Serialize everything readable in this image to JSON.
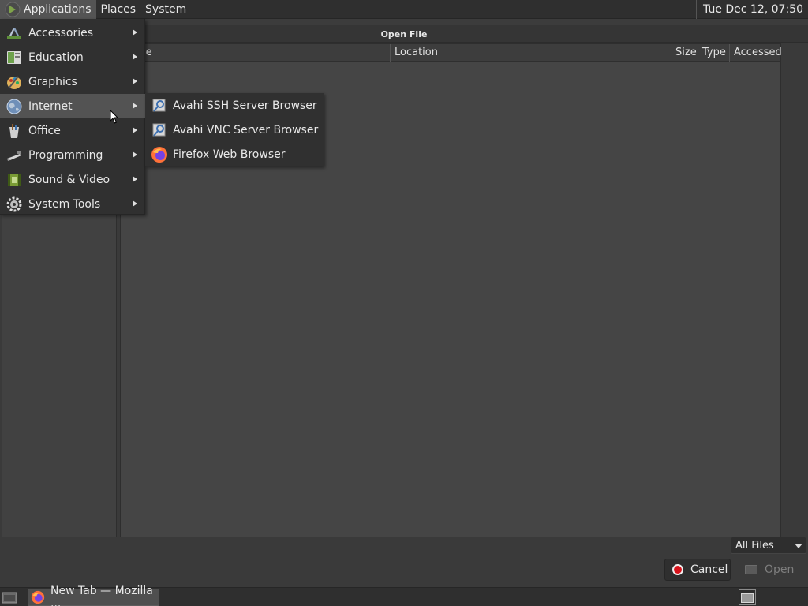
{
  "top_panel": {
    "menus": [
      {
        "label": "Applications"
      },
      {
        "label": "Places"
      },
      {
        "label": "System"
      }
    ],
    "clock": "Tue Dec 12, 07:50"
  },
  "dialog": {
    "title": "Open File",
    "columns": [
      "me",
      "Location",
      "Size",
      "Type",
      "Accessed"
    ],
    "filter": {
      "selected": "All Files"
    },
    "buttons": {
      "cancel": "Cancel",
      "open": "Open"
    }
  },
  "app_menu": {
    "items": [
      {
        "label": "Accessories",
        "icon": "accessories-icon"
      },
      {
        "label": "Education",
        "icon": "education-icon"
      },
      {
        "label": "Graphics",
        "icon": "graphics-icon"
      },
      {
        "label": "Internet",
        "icon": "internet-globe-icon"
      },
      {
        "label": "Office",
        "icon": "office-icon"
      },
      {
        "label": "Programming",
        "icon": "programming-icon"
      },
      {
        "label": "Sound & Video",
        "icon": "sound-video-icon"
      },
      {
        "label": "System Tools",
        "icon": "system-tools-gear-icon"
      }
    ],
    "active_item": "Internet"
  },
  "internet_submenu": {
    "items": [
      {
        "label": "Avahi SSH Server Browser",
        "icon": "avahi-icon"
      },
      {
        "label": "Avahi VNC Server Browser",
        "icon": "avahi-icon"
      },
      {
        "label": "Firefox Web Browser",
        "icon": "firefox-icon"
      }
    ]
  },
  "bottom_panel": {
    "task": {
      "label": "New Tab — Mozilla ...",
      "icon": "firefox-icon"
    }
  },
  "colors": {
    "panel": "#2f2f2f",
    "menu_bg": "#303030",
    "menu_highlight": "#535353",
    "cancel_red": "#d7121b"
  }
}
